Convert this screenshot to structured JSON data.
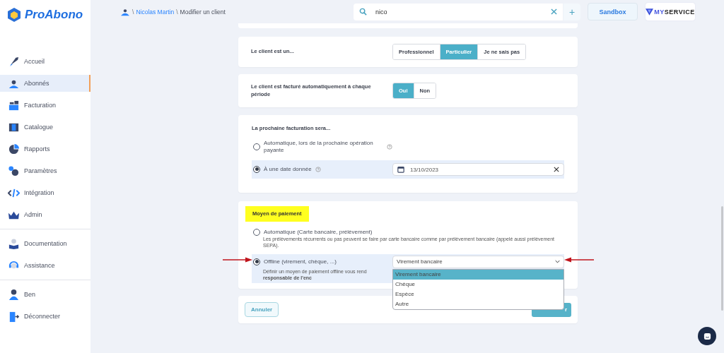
{
  "brand": {
    "name": "ProAbono"
  },
  "sidebar": {
    "groups": [
      [
        {
          "label": "Accueil",
          "selected": false
        },
        {
          "label": "Abonnés",
          "selected": true
        },
        {
          "label": "Facturation",
          "selected": false
        },
        {
          "label": "Catalogue",
          "selected": false
        },
        {
          "label": "Rapports",
          "selected": false
        },
        {
          "label": "Paramètres",
          "selected": false
        },
        {
          "label": "Intégration",
          "selected": false
        },
        {
          "label": "Admin",
          "selected": false
        }
      ],
      [
        {
          "label": "Documentation",
          "selected": false
        },
        {
          "label": "Assistance",
          "selected": false
        }
      ],
      [
        {
          "label": "Ben",
          "selected": false
        },
        {
          "label": "Déconnecter",
          "selected": false
        }
      ]
    ]
  },
  "breadcrumb": {
    "separator": "\\",
    "items": [
      {
        "label": "Nicolas Martin",
        "kind": "link"
      },
      {
        "label": "Modifier un client",
        "kind": "current"
      }
    ]
  },
  "search": {
    "value": "nico"
  },
  "add_button": "+",
  "environment_button": "Sandbox",
  "account_logo": {
    "prefix": "MY",
    "rest": "SERVICE"
  },
  "client_type": {
    "label": "Le client est un...",
    "options": [
      {
        "label": "Professionnel",
        "selected": false
      },
      {
        "label": "Particulier",
        "selected": true
      },
      {
        "label": "Je ne sais pas",
        "selected": false
      }
    ]
  },
  "auto_billing": {
    "label": "Le client est facturé automatiquement à chaque période",
    "options": [
      {
        "label": "Oui",
        "selected": true
      },
      {
        "label": "Non",
        "selected": false
      }
    ]
  },
  "next_billing": {
    "title": "La prochaine facturation sera...",
    "options": [
      {
        "label": "Automatique, lors de la prochaine opération payante",
        "help": true,
        "selected": false
      },
      {
        "label": "À une date donnée",
        "help": true,
        "selected": true,
        "date": "13/10/2023"
      }
    ]
  },
  "payment": {
    "title": "Moyen de paiement",
    "options": [
      {
        "label": "Automatique (Carte bancaire, prélèvement)",
        "description": "Les prélèvements récurrents ou pas peuvent se faire par carte bancaire comme par prélèvement bancaire (appelé aussi prélèvement SEPA).",
        "selected": false
      },
      {
        "label": "Offline (virement, chèque, ...)",
        "description": "Définir un moyen de paiement offline vous rend **responsable de l'enc**",
        "selected": true
      }
    ],
    "select": {
      "value": "Virement bancaire",
      "open": true,
      "options": [
        {
          "label": "Virement bancaire",
          "selected": true
        },
        {
          "label": "Chèque",
          "selected": false
        },
        {
          "label": "Espèce",
          "selected": false
        },
        {
          "label": "Autre",
          "selected": false
        }
      ]
    }
  },
  "buttons": {
    "cancel": "Annuler",
    "save": "r"
  }
}
